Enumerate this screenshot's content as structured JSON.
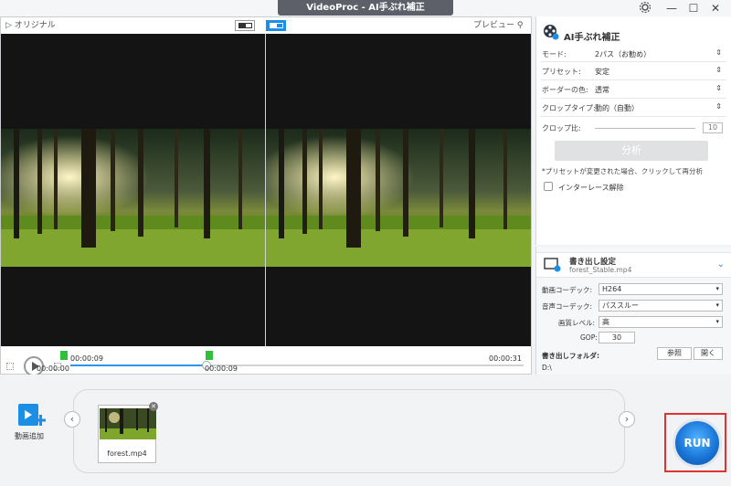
{
  "window": {
    "title": "VideoProc - AI手ぶれ補正",
    "settings_icon": "gear-icon",
    "minimize": "—",
    "maximize": "☐",
    "close": "✕"
  },
  "preview": {
    "original_label": "オリジナル",
    "preview_label": "プレビュー"
  },
  "timeline": {
    "current_time": "00:00:09",
    "total_time": "00:00:31",
    "start_marker": "00:00:00",
    "end_marker": "00:00:09",
    "progress": 0.3
  },
  "stabilize_panel": {
    "title": "AI手ぶれ補正",
    "rows": [
      {
        "label": "モード:",
        "value": "2パス（お勧め）"
      },
      {
        "label": "プリセット:",
        "value": "安定"
      },
      {
        "label": "ボーダーの色:",
        "value": "透常"
      },
      {
        "label": "クロップタイプ:",
        "value": "動的（自動）"
      }
    ],
    "crop_ratio_label": "クロップ比:",
    "crop_ratio_value": "10",
    "analyze_button": "分析",
    "note": "*プリセットが変更された場合、クリックして再分析",
    "deinterlace_label": "インターレース解除"
  },
  "export": {
    "title": "書き出し設定",
    "filename": "forest_Stable.mp4",
    "video_codec_label": "動画コーデック:",
    "video_codec_value": "H264",
    "audio_codec_label": "音声コーデック:",
    "audio_codec_value": "パススルー",
    "quality_label": "画質レベル:",
    "quality_value": "高",
    "gop_label": "GOP:",
    "gop_value": "30",
    "folder_label": "書き出しフォルダ:",
    "browse_button": "参照",
    "open_button": "開く",
    "folder_path": "D:\\"
  },
  "bottom": {
    "add_video_label": "動画追加",
    "file_name": "forest.mp4",
    "run_label": "RUN"
  }
}
